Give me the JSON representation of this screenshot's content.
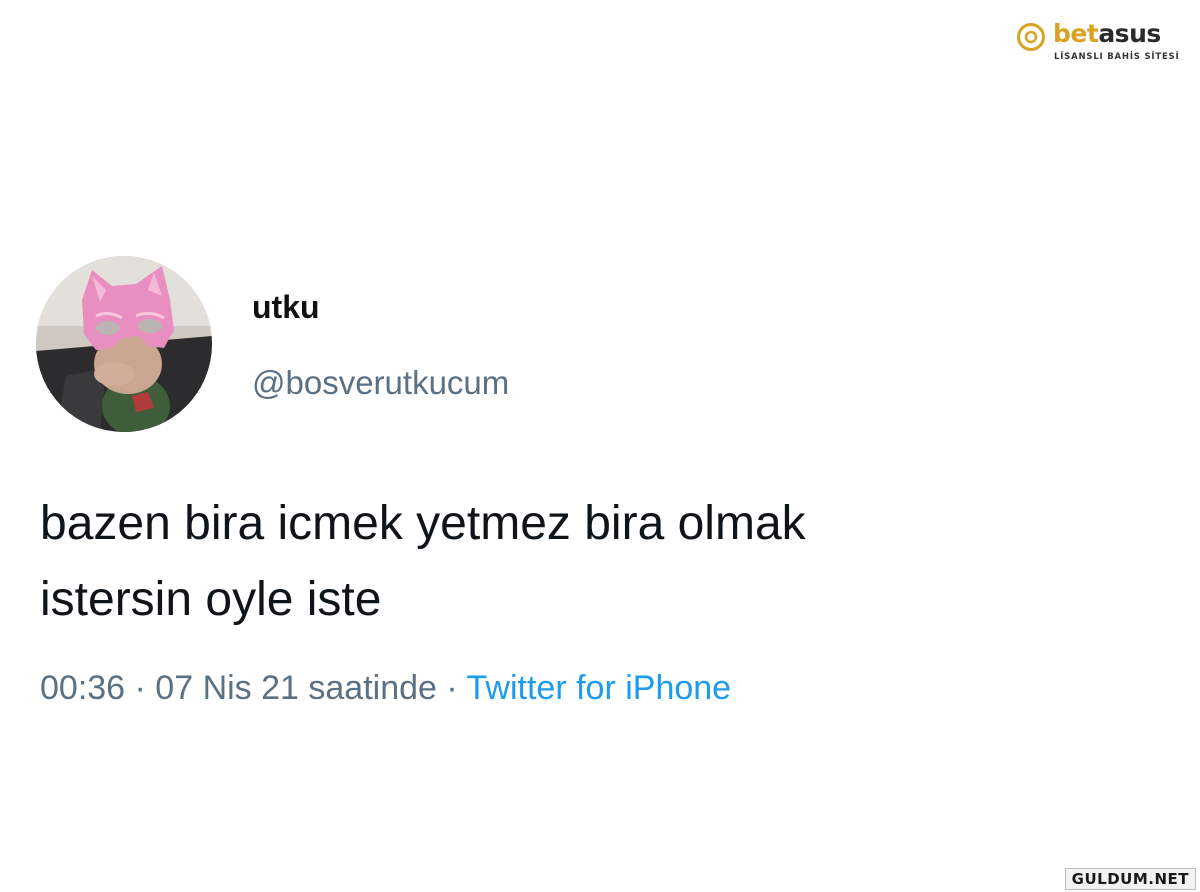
{
  "brand": {
    "name_part1": "bet",
    "name_part2": "asus",
    "tagline": "LİSANSLI BAHİS SİTESİ",
    "accent_color": "#d9a322"
  },
  "tweet": {
    "avatar_icon": "profile-photo-pink-mask",
    "display_name": "utku",
    "handle": "@bosverutkucum",
    "text_lines": [
      "bazen bira icmek yetmez bira olmak",
      "istersin oyle iste"
    ],
    "timestamp": "00:36 · 07 Nis 21 saatinde · ",
    "source": "Twitter for iPhone",
    "source_color": "#1d9bf0"
  },
  "watermark": {
    "text": "GULDUM.NET"
  }
}
